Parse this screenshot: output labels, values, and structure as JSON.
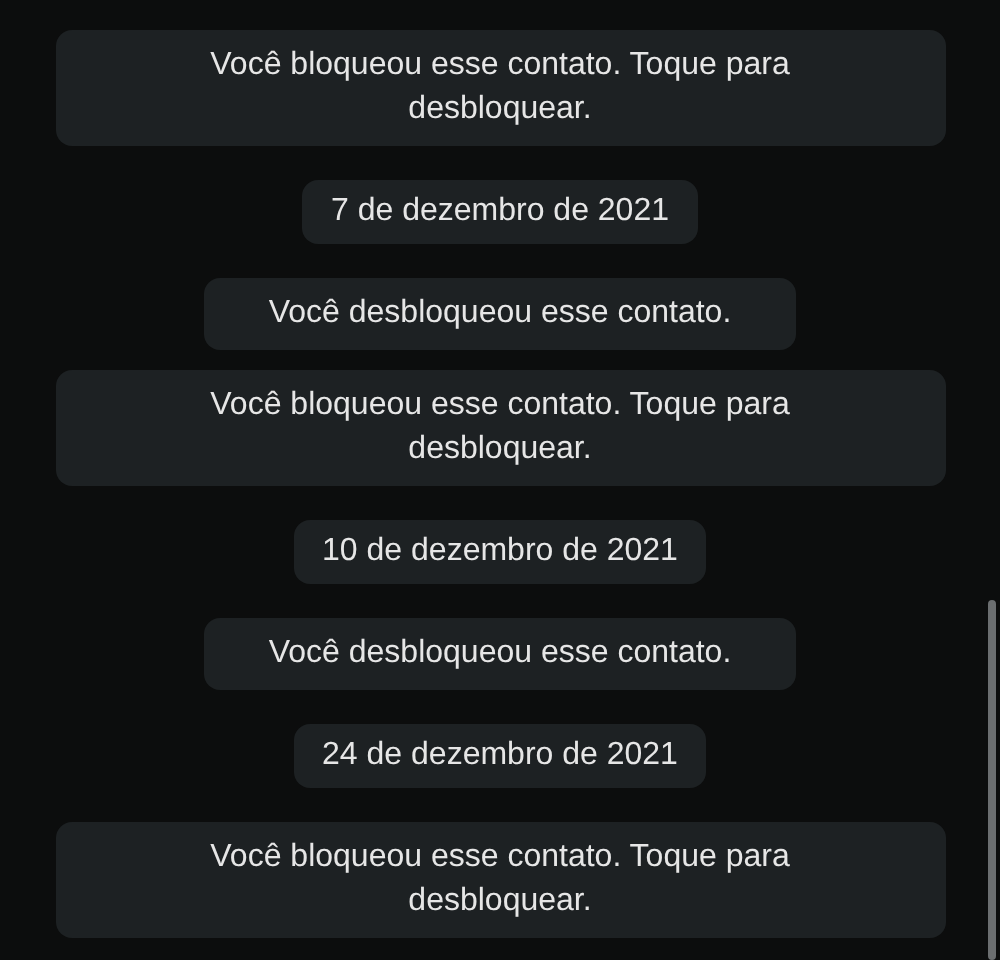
{
  "messages": [
    {
      "kind": "system",
      "text": "Você bloqueou esse contato. Toque para desbloquear."
    },
    {
      "kind": "date",
      "text": "7 de dezembro de 2021"
    },
    {
      "kind": "system",
      "text": "Você desbloqueou esse contato."
    },
    {
      "kind": "system",
      "text": "Você bloqueou esse contato. Toque para desbloquear."
    },
    {
      "kind": "date",
      "text": "10 de dezembro de 2021"
    },
    {
      "kind": "system",
      "text": "Você desbloqueou esse contato."
    },
    {
      "kind": "date",
      "text": "24 de dezembro de 2021"
    },
    {
      "kind": "system",
      "text": "Você bloqueou esse contato. Toque para desbloquear."
    }
  ]
}
